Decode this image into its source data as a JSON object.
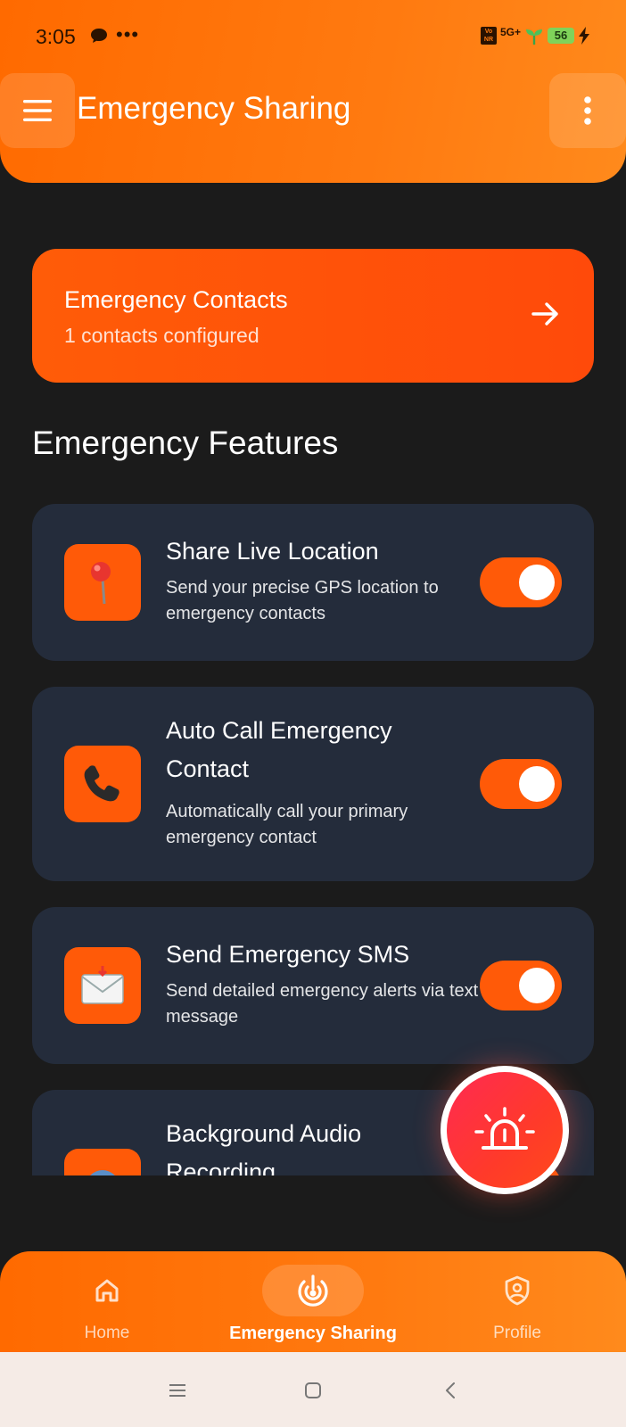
{
  "status_bar": {
    "time": "3:05",
    "dots": "•••",
    "volte": "Vo NR",
    "network": "5G+",
    "battery": "56"
  },
  "header": {
    "title": "Emergency Sharing"
  },
  "contacts_card": {
    "title": "Emergency Contacts",
    "subtitle": "1 contacts configured"
  },
  "features_section": {
    "title": "Emergency Features"
  },
  "features": [
    {
      "title": "Share Live Location",
      "description": "Send your precise GPS location to emergency contacts",
      "icon": "pin-icon",
      "enabled": true
    },
    {
      "title": "Auto Call Emergency Contact",
      "description": "Automatically call your primary emergency contact",
      "icon": "phone-icon",
      "enabled": true
    },
    {
      "title": "Send Emergency SMS",
      "description": "Send detailed emergency alerts via text message",
      "icon": "envelope-icon",
      "enabled": true
    },
    {
      "title": "Background Audio Recording",
      "description": "",
      "icon": "globe-icon",
      "enabled": true
    }
  ],
  "bottom_nav": {
    "items": [
      {
        "label": "Home",
        "icon": "home-icon",
        "active": false
      },
      {
        "label": "Emergency Sharing",
        "icon": "emergency-target-icon",
        "active": true
      },
      {
        "label": "Profile",
        "icon": "shield-user-icon",
        "active": false
      }
    ]
  },
  "colors": {
    "accent": "#ff5a08",
    "header": "#ff7a10",
    "card": "#242c3b",
    "background": "#1b1b1b",
    "sos": "#ff2a52"
  }
}
